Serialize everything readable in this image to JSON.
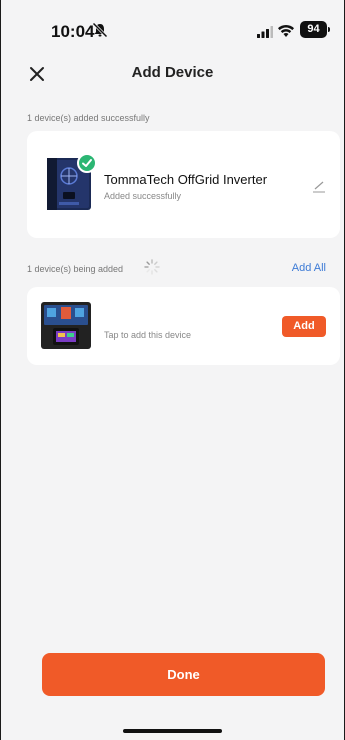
{
  "status_bar": {
    "time": "10:04",
    "battery": "94"
  },
  "header": {
    "title": "Add Device"
  },
  "added_section": {
    "label": "1 device(s) added successfully",
    "device": {
      "name": "TommaTech OffGrid Inverter",
      "status": "Added successfully"
    }
  },
  "pending_section": {
    "label": "1 device(s) being added",
    "add_all_label": "Add All",
    "device": {
      "tap_text": "Tap to add this device",
      "add_label": "Add"
    }
  },
  "footer": {
    "done_label": "Done"
  },
  "colors": {
    "accent": "#f05a28",
    "link": "#3d7bd6",
    "success": "#2bb673"
  },
  "icons": [
    "bell-off-icon",
    "signal-icon",
    "wifi-icon",
    "battery-icon",
    "close-icon",
    "loading-spinner-icon",
    "check-icon",
    "edit-icon"
  ]
}
